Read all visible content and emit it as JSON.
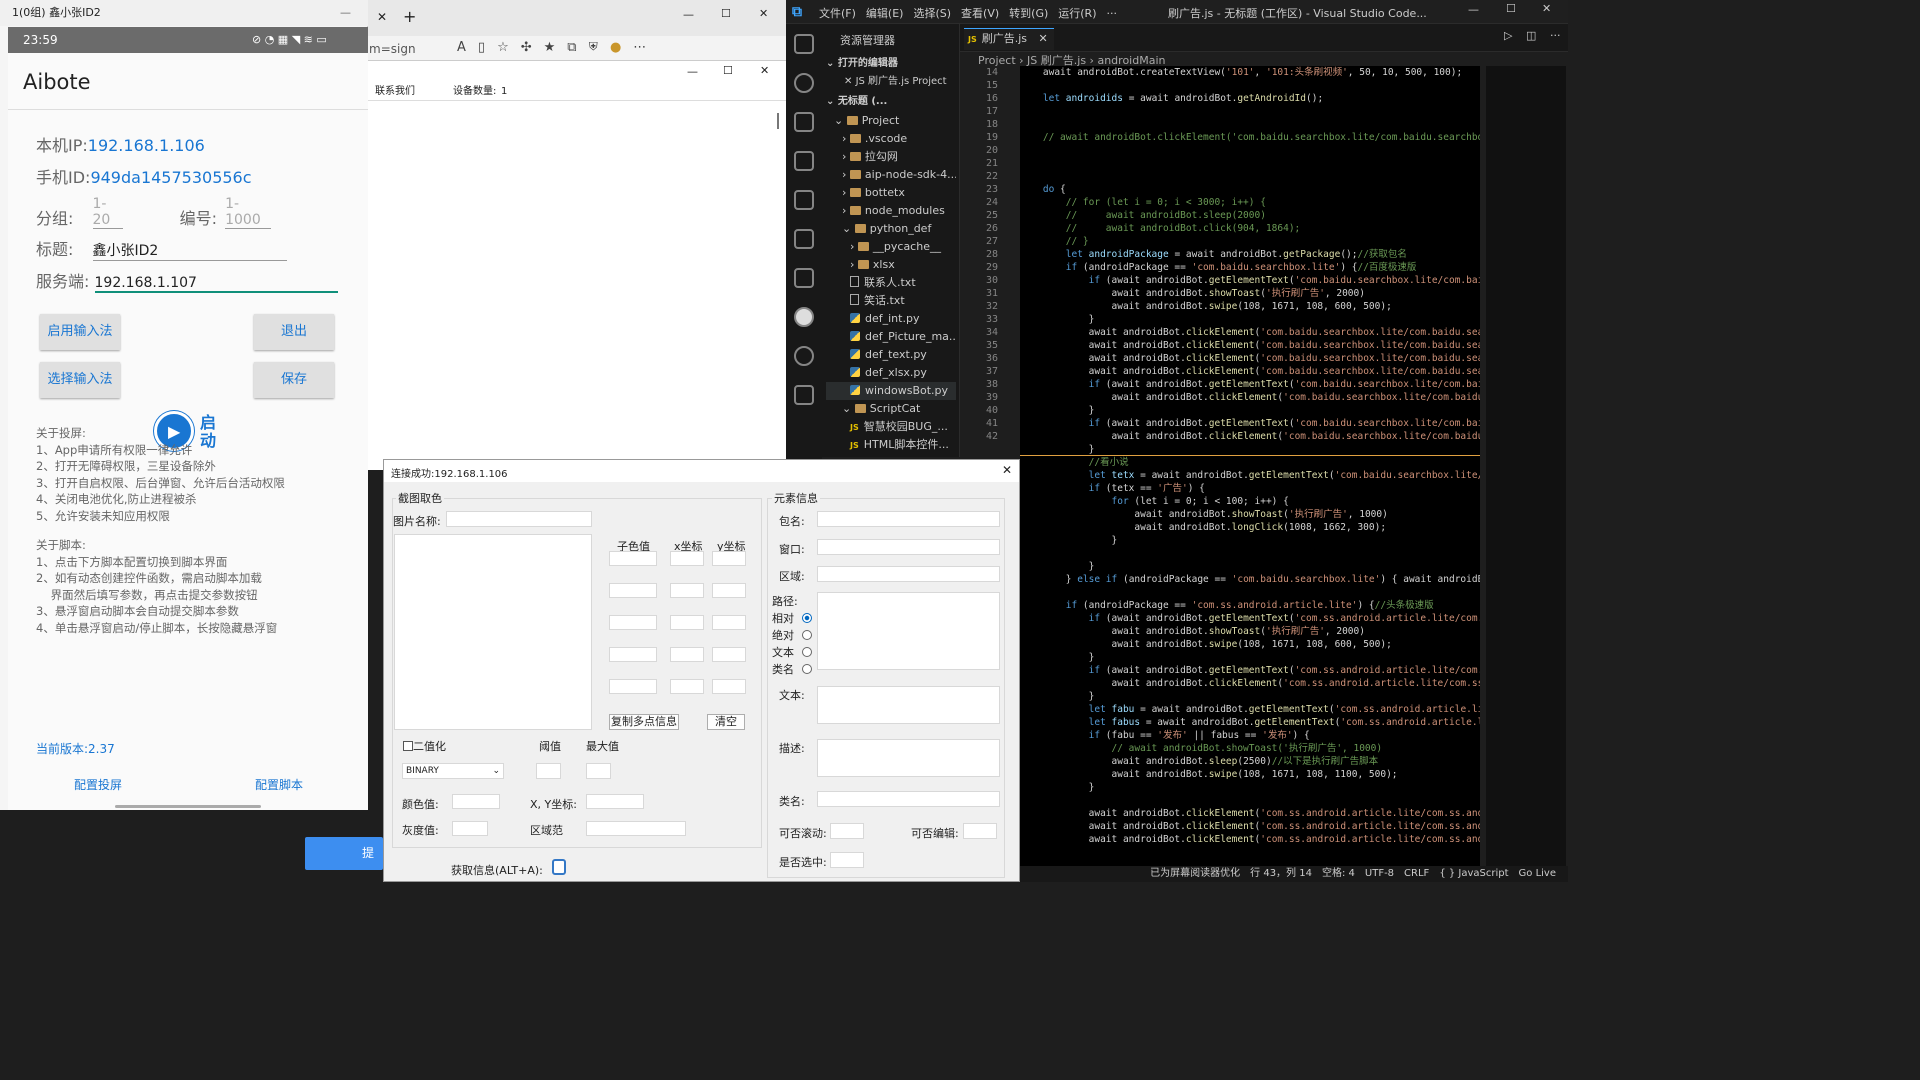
{
  "vscode": {
    "menus": [
      "文件(F)",
      "编辑(E)",
      "选择(S)",
      "查看(V)",
      "转到(G)",
      "运行(R)",
      "···"
    ],
    "window_title": "刷广告.js - 无标题 (工作区) - Visual Studio Code...",
    "explorer": {
      "title": "资源管理器",
      "open_editors": "打开的编辑器",
      "open_file": "JS 刷广告.js Project",
      "workspace": "无标题 (...",
      "items": [
        {
          "label": "Project",
          "type": "folder",
          "depth": 0
        },
        {
          "label": ".vscode",
          "type": "folder",
          "depth": 1
        },
        {
          "label": "拉勾网",
          "type": "folder",
          "depth": 1
        },
        {
          "label": "aip-node-sdk-4...",
          "type": "folder",
          "depth": 1
        },
        {
          "label": "bottetx",
          "type": "folder",
          "depth": 1
        },
        {
          "label": "node_modules",
          "type": "folder",
          "depth": 1
        },
        {
          "label": "python_def",
          "type": "folder",
          "depth": 1
        },
        {
          "label": "__pycache__",
          "type": "folder",
          "depth": 2
        },
        {
          "label": "xlsx",
          "type": "folder",
          "depth": 2
        },
        {
          "label": "联系人.txt",
          "type": "txt",
          "depth": 2
        },
        {
          "label": "笑话.txt",
          "type": "txt",
          "depth": 2
        },
        {
          "label": "def_int.py",
          "type": "py",
          "depth": 2
        },
        {
          "label": "def_Picture_ma...",
          "type": "py",
          "depth": 2
        },
        {
          "label": "def_text.py",
          "type": "py",
          "depth": 2
        },
        {
          "label": "def_xlsx.py",
          "type": "py",
          "depth": 2
        },
        {
          "label": "windowsBot.py",
          "type": "py",
          "depth": 2
        },
        {
          "label": "ScriptCat",
          "type": "folder",
          "depth": 1
        },
        {
          "label": "智慧校园BUG_...",
          "type": "js",
          "depth": 2
        },
        {
          "label": "HTML脚本控件...",
          "type": "js",
          "depth": 2
        }
      ]
    },
    "tab": "刷广告.js",
    "breadcrumb": [
      "Project",
      "JS 刷广告.js",
      "androidMain"
    ],
    "line_numbers": [
      14,
      15,
      16,
      17,
      18,
      19,
      20,
      21,
      22,
      23,
      24,
      25,
      26,
      27,
      28,
      29,
      30,
      31,
      32,
      33,
      34,
      35,
      36,
      37,
      38,
      39,
      40,
      41,
      42
    ],
    "code": [
      [
        [
          "pl",
          "    await androidBot.createTextView("
        ],
        [
          "str",
          "'101'"
        ],
        [
          "pl",
          ", "
        ],
        [
          "str",
          "'101:头条刷视频'"
        ],
        [
          "pl",
          ", 50, 10, 500, 100);"
        ]
      ],
      [
        [
          "pl",
          ""
        ]
      ],
      [
        [
          "kw",
          "    let "
        ],
        [
          "vr",
          "androidids"
        ],
        [
          "pl",
          " = await androidBot."
        ],
        [
          "fn",
          "getAndroidId"
        ],
        [
          "pl",
          "();"
        ]
      ],
      [
        [
          "pl",
          ""
        ]
      ],
      [
        [
          "pl",
          ""
        ]
      ],
      [
        [
          "cm",
          "    // await androidBot.clickElement('com.baidu.searchbox.lite/com.baidu.searchbox.lite"
        ]
      ],
      [
        [
          "pl",
          ""
        ]
      ],
      [
        [
          "pl",
          ""
        ]
      ],
      [
        [
          "pl",
          ""
        ]
      ],
      [
        [
          "kw",
          "    do "
        ],
        [
          "pl",
          "{"
        ]
      ],
      [
        [
          "cm",
          "        // for (let i = 0; i < 3000; i++) {"
        ]
      ],
      [
        [
          "cm",
          "        //     await androidBot.sleep(2000)"
        ]
      ],
      [
        [
          "cm",
          "        //     await androidBot.click(904, 1864);"
        ]
      ],
      [
        [
          "cm",
          "        // }"
        ]
      ],
      [
        [
          "kw",
          "        let "
        ],
        [
          "vr",
          "androidPackage"
        ],
        [
          "pl",
          " = await androidBot."
        ],
        [
          "fn",
          "getPackage"
        ],
        [
          "pl",
          "();"
        ],
        [
          "cm",
          "//获取包名"
        ]
      ],
      [
        [
          "kw",
          "        if "
        ],
        [
          "pl",
          "(androidPackage == "
        ],
        [
          "str",
          "'com.baidu.searchbox.lite'"
        ],
        [
          "pl",
          ") {"
        ],
        [
          "cm",
          "//百度极速版"
        ]
      ],
      [
        [
          "kw",
          "            if "
        ],
        [
          "pl",
          "(await androidBot."
        ],
        [
          "fn",
          "getElementText"
        ],
        [
          "pl",
          "("
        ],
        [
          "str",
          "'com.baidu.searchbox.lite/com.baidu.sea"
        ]
      ],
      [
        [
          "pl",
          "                await androidBot."
        ],
        [
          "fn",
          "showToast"
        ],
        [
          "pl",
          "("
        ],
        [
          "str",
          "'执行刷广告'"
        ],
        [
          "pl",
          ", 2000)"
        ]
      ],
      [
        [
          "pl",
          "                await androidBot."
        ],
        [
          "fn",
          "swipe"
        ],
        [
          "pl",
          "(108, 1671, 108, 600, 500);"
        ]
      ],
      [
        [
          "pl",
          "            }"
        ]
      ],
      [
        [
          "pl",
          "            await androidBot."
        ],
        [
          "fn",
          "clickElement"
        ],
        [
          "pl",
          "("
        ],
        [
          "str",
          "'com.baidu.searchbox.lite/com.baidu.searchbox"
        ]
      ],
      [
        [
          "pl",
          "            await androidBot."
        ],
        [
          "fn",
          "clickElement"
        ],
        [
          "pl",
          "("
        ],
        [
          "str",
          "'com.baidu.searchbox.lite/com.baidu.searchbox"
        ]
      ],
      [
        [
          "pl",
          "            await androidBot."
        ],
        [
          "fn",
          "clickElement"
        ],
        [
          "pl",
          "("
        ],
        [
          "str",
          "'com.baidu.searchbox.lite/com.baidu.searchbox"
        ]
      ],
      [
        [
          "pl",
          "            await androidBot."
        ],
        [
          "fn",
          "clickElement"
        ],
        [
          "pl",
          "("
        ],
        [
          "str",
          "'com.baidu.searchbox.lite/com.baidu.searchbox"
        ]
      ],
      [
        [
          "kw",
          "            if "
        ],
        [
          "pl",
          "(await androidBot."
        ],
        [
          "fn",
          "getElementText"
        ],
        [
          "pl",
          "("
        ],
        [
          "str",
          "'com.baidu.searchbox.lite/com.baidu.sea"
        ]
      ],
      [
        [
          "pl",
          "                await androidBot."
        ],
        [
          "fn",
          "clickElement"
        ],
        [
          "pl",
          "("
        ],
        [
          "str",
          "'com.baidu.searchbox.lite/com.baidu.searc"
        ]
      ],
      [
        [
          "pl",
          "            }"
        ]
      ],
      [
        [
          "kw",
          "            if "
        ],
        [
          "pl",
          "(await androidBot."
        ],
        [
          "fn",
          "getElementText"
        ],
        [
          "pl",
          "("
        ],
        [
          "str",
          "'com.baidu.searchbox.lite/com.baidu.sea"
        ]
      ],
      [
        [
          "pl",
          "                await androidBot."
        ],
        [
          "fn",
          "clickElement"
        ],
        [
          "pl",
          "("
        ],
        [
          "str",
          "'com.baidu.searchbox.lite/com.baidu.searc"
        ]
      ],
      [
        [
          "pl",
          "            }"
        ]
      ],
      [
        [
          "cm",
          "            //看小说"
        ]
      ],
      [
        [
          "kw",
          "            let "
        ],
        [
          "vr",
          "tetx"
        ],
        [
          "pl",
          " = await androidBot."
        ],
        [
          "fn",
          "getElementText"
        ],
        [
          "pl",
          "("
        ],
        [
          "str",
          "'com.baidu.searchbox.lite/com.ba"
        ]
      ],
      [
        [
          "kw",
          "            if "
        ],
        [
          "pl",
          "(tetx == "
        ],
        [
          "str",
          "'广告'"
        ],
        [
          "pl",
          ") {"
        ]
      ],
      [
        [
          "kw",
          "                for "
        ],
        [
          "pl",
          "(let i = 0; i < 100; i++) {"
        ]
      ],
      [
        [
          "pl",
          "                    await androidBot."
        ],
        [
          "fn",
          "showToast"
        ],
        [
          "pl",
          "("
        ],
        [
          "str",
          "'执行刷广告'"
        ],
        [
          "pl",
          ", 1000)"
        ]
      ],
      [
        [
          "pl",
          "                    await androidBot."
        ],
        [
          "fn",
          "longClick"
        ],
        [
          "pl",
          "(1008, 1662, 300);"
        ]
      ],
      [
        [
          "pl",
          "                }"
        ]
      ],
      [
        [
          "pl",
          ""
        ]
      ],
      [
        [
          "pl",
          "            }"
        ]
      ],
      [
        [
          "pl",
          "        } "
        ],
        [
          "kw",
          "else if "
        ],
        [
          "pl",
          "(androidPackage == "
        ],
        [
          "str",
          "'com.baidu.searchbox.lite'"
        ],
        [
          "pl",
          ") { await androidBot.sho"
        ]
      ],
      [
        [
          "pl",
          ""
        ]
      ],
      [
        [
          "kw",
          "        if "
        ],
        [
          "pl",
          "(androidPackage == "
        ],
        [
          "str",
          "'com.ss.android.article.lite'"
        ],
        [
          "pl",
          ") {"
        ],
        [
          "cm",
          "//头条极速版"
        ]
      ],
      [
        [
          "kw",
          "            if "
        ],
        [
          "pl",
          "(await androidBot."
        ],
        [
          "fn",
          "getElementText"
        ],
        [
          "pl",
          "("
        ],
        [
          "str",
          "'com.ss.android.article.lite/com.ss.anc"
        ]
      ],
      [
        [
          "pl",
          "                await androidBot."
        ],
        [
          "fn",
          "showToast"
        ],
        [
          "pl",
          "("
        ],
        [
          "str",
          "'执行刷广告'"
        ],
        [
          "pl",
          ", 2000)"
        ]
      ],
      [
        [
          "pl",
          "                await androidBot."
        ],
        [
          "fn",
          "swipe"
        ],
        [
          "pl",
          "(108, 1671, 108, 600, 500);"
        ]
      ],
      [
        [
          "pl",
          "            }"
        ]
      ],
      [
        [
          "kw",
          "            if "
        ],
        [
          "pl",
          "(await androidBot."
        ],
        [
          "fn",
          "getElementText"
        ],
        [
          "pl",
          "("
        ],
        [
          "str",
          "'com.ss.android.article.lite/com.ss.anc"
        ]
      ],
      [
        [
          "pl",
          "                await androidBot."
        ],
        [
          "fn",
          "clickElement"
        ],
        [
          "pl",
          "("
        ],
        [
          "str",
          "'com.ss.android.article.lite/com.ss.andro"
        ]
      ],
      [
        [
          "pl",
          "            }"
        ]
      ],
      [
        [
          "kw",
          "            let "
        ],
        [
          "vr",
          "fabu"
        ],
        [
          "pl",
          " = await androidBot."
        ],
        [
          "fn",
          "getElementText"
        ],
        [
          "pl",
          "("
        ],
        [
          "str",
          "'com.ss.android.article.lite/com"
        ]
      ],
      [
        [
          "kw",
          "            let "
        ],
        [
          "vr",
          "fabus"
        ],
        [
          "pl",
          " = await androidBot."
        ],
        [
          "fn",
          "getElementText"
        ],
        [
          "pl",
          "("
        ],
        [
          "str",
          "'com.ss.android.article.lite/cc"
        ]
      ],
      [
        [
          "kw",
          "            if "
        ],
        [
          "pl",
          "(fabu == "
        ],
        [
          "str",
          "'发布'"
        ],
        [
          "pl",
          " || fabus == "
        ],
        [
          "str",
          "'发布'"
        ],
        [
          "pl",
          ") {"
        ]
      ],
      [
        [
          "cm",
          "                // await androidBot.showToast('执行刷广告', 1000)"
        ]
      ],
      [
        [
          "pl",
          "                await androidBot."
        ],
        [
          "fn",
          "sleep"
        ],
        [
          "pl",
          "(2500)"
        ],
        [
          "cm",
          "//以下是执行刷广告脚本"
        ]
      ],
      [
        [
          "pl",
          "                await androidBot."
        ],
        [
          "fn",
          "swipe"
        ],
        [
          "pl",
          "(108, 1671, 108, 1100, 500);"
        ]
      ],
      [
        [
          "pl",
          "            }"
        ]
      ],
      [
        [
          "pl",
          ""
        ]
      ],
      [
        [
          "pl",
          "            await androidBot."
        ],
        [
          "fn",
          "clickElement"
        ],
        [
          "pl",
          "("
        ],
        [
          "str",
          "'com.ss.android.article.lite/com.ss.android.a"
        ]
      ],
      [
        [
          "pl",
          "            await androidBot."
        ],
        [
          "fn",
          "clickElement"
        ],
        [
          "pl",
          "("
        ],
        [
          "str",
          "'com.ss.android.article.lite/com.ss.android.a"
        ]
      ],
      [
        [
          "pl",
          "            await androidBot."
        ],
        [
          "fn",
          "clickElement"
        ],
        [
          "pl",
          "("
        ],
        [
          "str",
          "'com.ss.android.article.lite/com.ss.android.a"
        ]
      ]
    ],
    "status": [
      "已为屏幕阅读器优化",
      "行 43，列 14",
      "空格: 4",
      "UTF-8",
      "CRLF",
      "{ } JavaScript",
      "Go Live"
    ]
  },
  "edge": {
    "address": "m=sign",
    "contact": "联系我们",
    "device_count_label": "设备数量:",
    "device_count": "1"
  },
  "aibote": {
    "window_title": "1(0组) 鑫小张ID2",
    "time": "23:59",
    "app_title": "Aibote",
    "ip_label": "本机IP:",
    "ip": "192.168.1.106",
    "phone_label": "手机ID:",
    "phone_id": "949da1457530556c",
    "group_label": "分组:",
    "group_ph": "1-20",
    "num_label": "编号:",
    "num_ph": "1-1000",
    "title_label": "标题:",
    "title_value": "鑫小张ID2",
    "server_label": "服务端:",
    "server_value": "192.168.1.107",
    "btn_enable_ime": "启用输入法",
    "btn_exit": "退出",
    "btn_select_ime": "选择输入法",
    "btn_save": "保存",
    "float_label": "启\n动",
    "about_cast": "关于投屏:\n1、App申请所有权限一律允许\n2、打开无障碍权限，三星设备除外\n3、打开自启权限、后台弹窗、允许后台活动权限\n4、关闭电池优化,防止进程被杀\n5、允许安装未知应用权限",
    "about_script": "关于脚本:\n1、点击下方脚本配置切换到脚本界面\n2、如有动态创建控件函数，需启动脚本加载\n    界面然后填写参数，再点击提交参数按钮\n3、悬浮窗启动脚本会自动提交脚本参数\n4、单击悬浮窗启动/停止脚本，长按隐藏悬浮窗",
    "version": "当前版本:2.37",
    "nav_cast": "配置投屏",
    "nav_script": "配置脚本",
    "submit_partial": "提交"
  },
  "dialog": {
    "title": "连接成功:192.168.1.106",
    "capture_group": "截图取色",
    "img_name": "图片名称:",
    "col_sub": "子色值",
    "col_x": "x坐标",
    "col_y": "y坐标",
    "copy_btn": "复制多点信息",
    "clear_btn": "清空",
    "binarize": "二值化",
    "threshold": "阈值",
    "maxval": "最大值",
    "binary_select": "BINARY",
    "color_val": "颜色值:",
    "xy": "X, Y坐标:",
    "gray": "灰度值:",
    "region": "区域范",
    "get_info": "获取信息(ALT+A):",
    "elem_group": "元素信息",
    "pkg": "包名:",
    "window": "窗口:",
    "area": "区域:",
    "path": "路径:",
    "radios": [
      "相对",
      "绝对",
      "文本",
      "类名"
    ],
    "text": "文本:",
    "desc": "描述:",
    "cls": "类名:",
    "scroll": "可否滚动:",
    "editable": "可否编辑:",
    "selected": "是否选中:"
  }
}
